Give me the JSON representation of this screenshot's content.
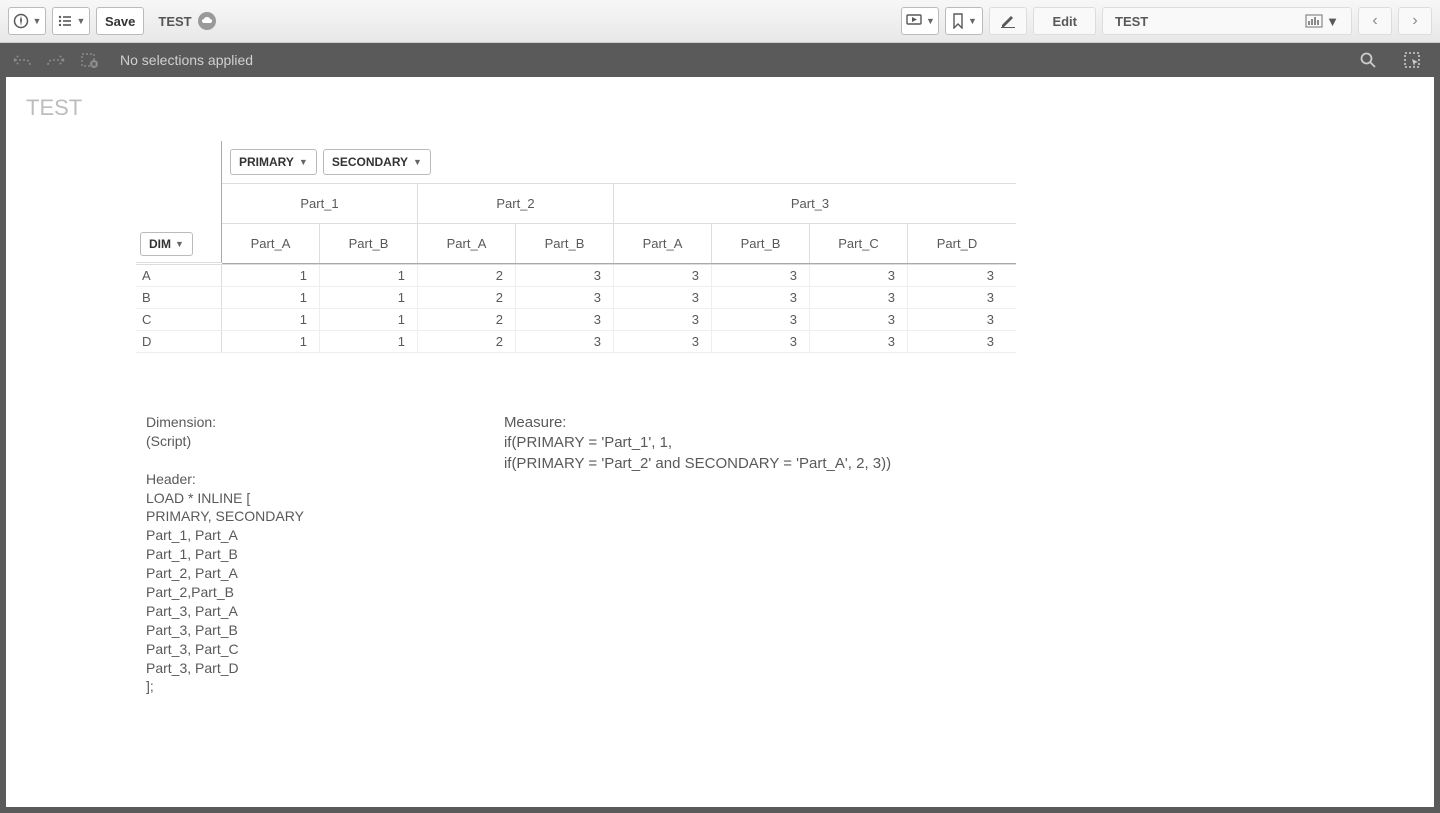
{
  "toolbar": {
    "save_label": "Save",
    "app_name": "TEST",
    "edit_label": "Edit",
    "sheet_name": "TEST"
  },
  "selection_bar": {
    "message": "No selections applied"
  },
  "sheet": {
    "title": "TEST"
  },
  "pivot": {
    "dim_dropdowns": [
      "PRIMARY",
      "SECONDARY"
    ],
    "row_dim_label": "DIM",
    "primary_headers": [
      {
        "label": "Part_1",
        "span": 2
      },
      {
        "label": "Part_2",
        "span": 2
      },
      {
        "label": "Part_3",
        "span": 4
      }
    ],
    "secondary_headers": [
      "Part_A",
      "Part_B",
      "Part_A",
      "Part_B",
      "Part_A",
      "Part_B",
      "Part_C",
      "Part_D"
    ],
    "rows": [
      {
        "label": "A",
        "values": [
          1,
          1,
          2,
          3,
          3,
          3,
          3,
          3
        ]
      },
      {
        "label": "B",
        "values": [
          1,
          1,
          2,
          3,
          3,
          3,
          3,
          3
        ]
      },
      {
        "label": "C",
        "values": [
          1,
          1,
          2,
          3,
          3,
          3,
          3,
          3
        ]
      },
      {
        "label": "D",
        "values": [
          1,
          1,
          2,
          3,
          3,
          3,
          3,
          3
        ]
      }
    ]
  },
  "text_blocks": {
    "dimension": "Dimension:\n(Script)\n\nHeader:\nLOAD * INLINE [\nPRIMARY, SECONDARY\nPart_1, Part_A\nPart_1, Part_B\nPart_2, Part_A\nPart_2,Part_B\nPart_3, Part_A\nPart_3, Part_B\nPart_3, Part_C\nPart_3, Part_D\n];",
    "measure": "Measure:\nif(PRIMARY = 'Part_1', 1,\nif(PRIMARY = 'Part_2' and SECONDARY = 'Part_A', 2, 3))"
  }
}
